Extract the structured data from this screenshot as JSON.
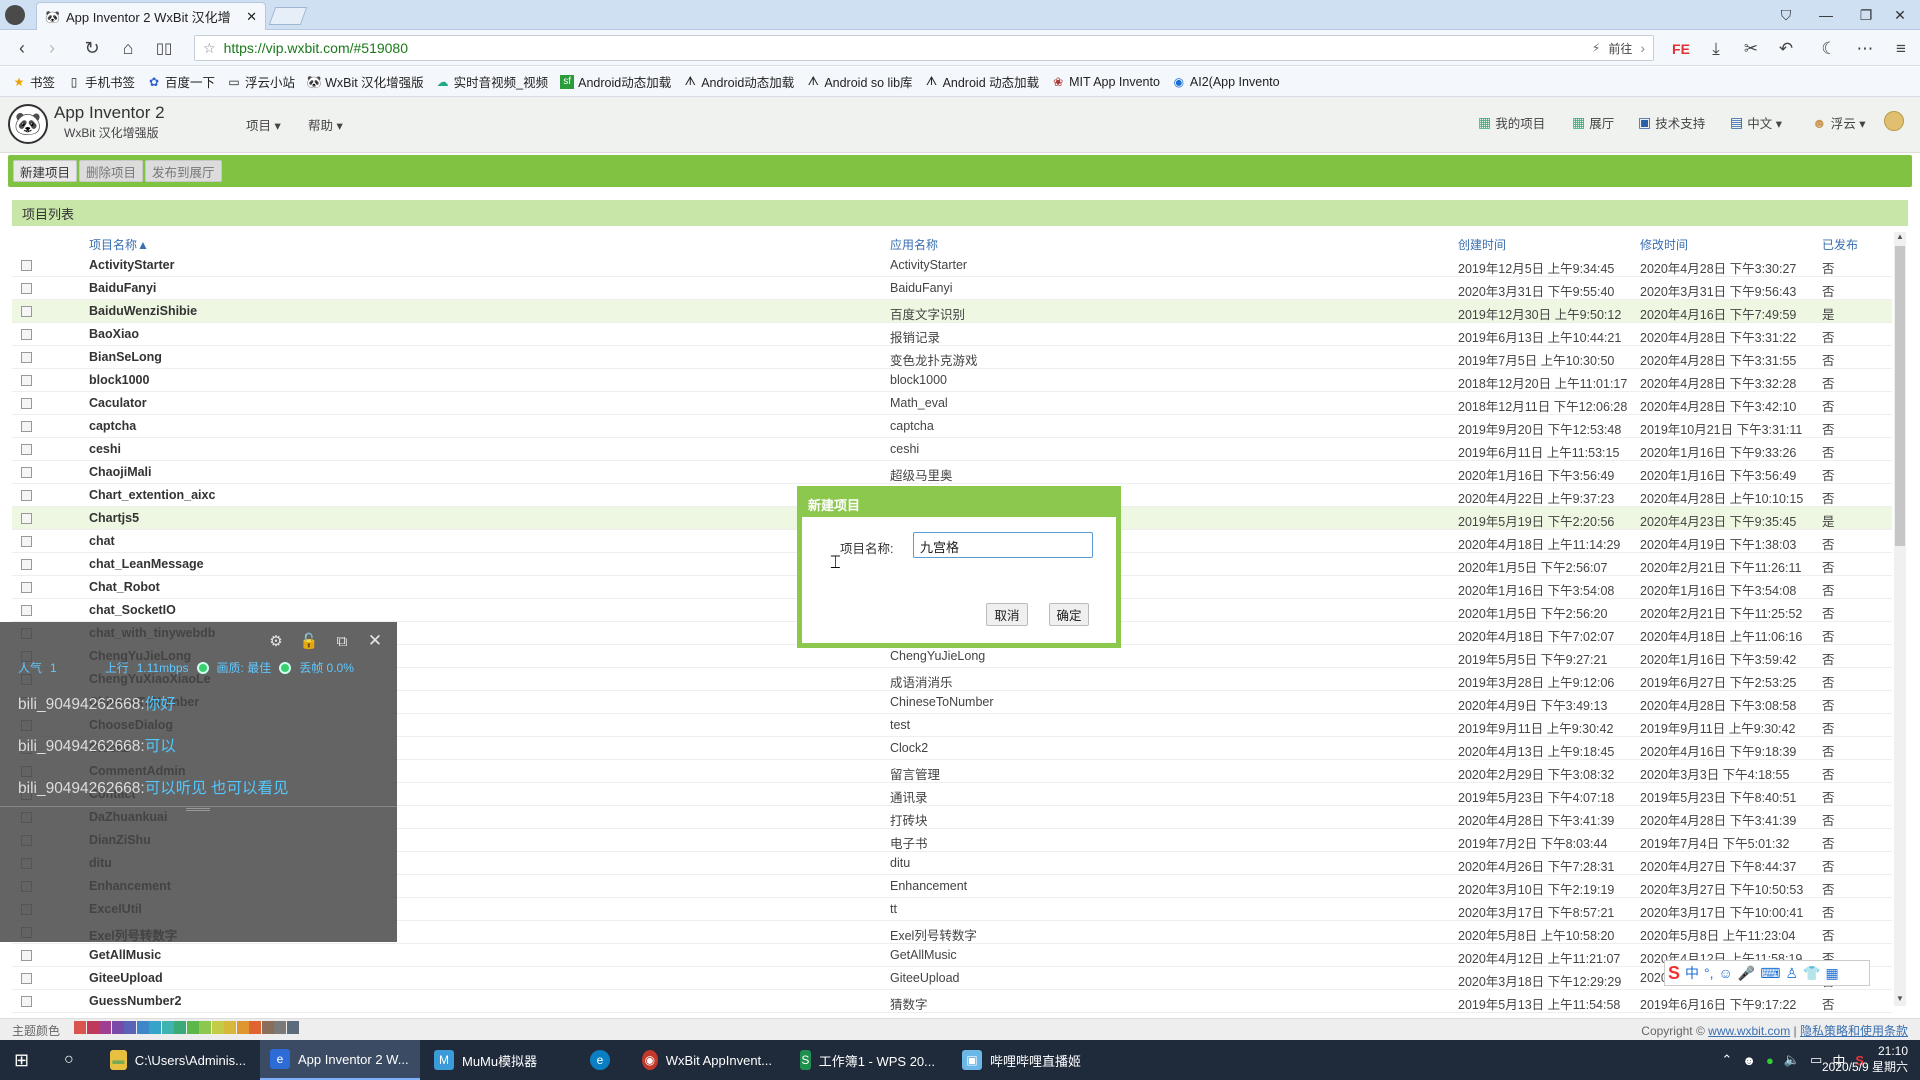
{
  "browser": {
    "tab_title": "App Inventor 2 WxBit 汉化增",
    "url": "https://vip.wxbit.com/#519080",
    "go_label": "前往",
    "bookmarks": [
      "书签",
      "手机书签",
      "百度一下",
      "浮云小站",
      "WxBit 汉化增强版",
      "实时音视频_视频",
      "Android动态加载",
      "Android动态加载",
      "Android so lib库",
      "Android 动态加载",
      "MIT App Invento",
      "AI2(App Invento"
    ]
  },
  "app": {
    "title": "App Inventor 2",
    "subtitle": "WxBit 汉化增强版",
    "menu": [
      "项目 ▾",
      "帮助 ▾"
    ],
    "right_menu": [
      "我的项目",
      "展厅",
      "技术支持",
      "中文 ▾",
      "浮云 ▾"
    ]
  },
  "toolbar": {
    "new": "新建项目",
    "delete": "删除项目",
    "publish": "发布到展厅"
  },
  "list": {
    "heading": "项目列表",
    "columns": [
      "项目名称▲",
      "应用名称",
      "创建时间",
      "修改时间",
      "已发布"
    ],
    "rows": [
      [
        "ActivityStarter",
        "ActivityStarter",
        "2019年12月5日 上午9:34:45",
        "2020年4月28日 下午3:30:27",
        "否"
      ],
      [
        "BaiduFanyi",
        "BaiduFanyi",
        "2020年3月31日 下午9:55:40",
        "2020年3月31日 下午9:56:43",
        "否"
      ],
      [
        "BaiduWenziShibie",
        "百度文字识别",
        "2019年12月30日 上午9:50:12",
        "2020年4月16日 下午7:49:59",
        "是"
      ],
      [
        "BaoXiao",
        "报销记录",
        "2019年6月13日 上午10:44:21",
        "2020年4月28日 下午3:31:22",
        "否"
      ],
      [
        "BianSeLong",
        "变色龙扑克游戏",
        "2019年7月5日 上午10:30:50",
        "2020年4月28日 下午3:31:55",
        "否"
      ],
      [
        "block1000",
        "block1000",
        "2018年12月20日 上午11:01:17",
        "2020年4月28日 下午3:32:28",
        "否"
      ],
      [
        "Caculator",
        "Math_eval",
        "2018年12月11日 下午12:06:28",
        "2020年4月28日 下午3:42:10",
        "否"
      ],
      [
        "captcha",
        "captcha",
        "2019年9月20日 下午12:53:48",
        "2019年10月21日 下午3:31:11",
        "否"
      ],
      [
        "ceshi",
        "ceshi",
        "2019年6月11日 上午11:53:15",
        "2020年1月16日 下午9:33:26",
        "否"
      ],
      [
        "ChaojiMali",
        "超级马里奥",
        "2020年1月16日 下午3:56:49",
        "2020年1月16日 下午3:56:49",
        "否"
      ],
      [
        "Chart_extention_aixc",
        "",
        "2020年4月22日 上午9:37:23",
        "2020年4月28日 上午10:10:15",
        "否"
      ],
      [
        "Chartjs5",
        "",
        "2019年5月19日 下午2:20:56",
        "2020年4月23日 下午9:35:45",
        "是"
      ],
      [
        "chat",
        "",
        "2020年4月18日 上午11:14:29",
        "2020年4月19日 下午1:38:03",
        "否"
      ],
      [
        "chat_LeanMessage",
        "",
        "2020年1月5日 下午2:56:07",
        "2020年2月21日 下午11:26:11",
        "否"
      ],
      [
        "Chat_Robot",
        "",
        "2020年1月16日 下午3:54:08",
        "2020年1月16日 下午3:54:08",
        "否"
      ],
      [
        "chat_SocketIO",
        "",
        "2020年1月5日 下午2:56:20",
        "2020年2月21日 下午11:25:52",
        "否"
      ],
      [
        "chat_with_tinywebdb",
        "",
        "2020年4月18日 下午7:02:07",
        "2020年4月18日 上午11:06:16",
        "否"
      ],
      [
        "ChengYuJieLong",
        "ChengYuJieLong",
        "2019年5月5日 下午9:27:21",
        "2020年1月16日 下午3:59:42",
        "否"
      ],
      [
        "ChengYuXiaoXiaoLe",
        "成语消消乐",
        "2019年3月28日 上午9:12:06",
        "2019年6月27日 下午2:53:25",
        "否"
      ],
      [
        "ChineseToNumber",
        "ChineseToNumber",
        "2020年4月9日 下午3:49:13",
        "2020年4月28日 下午3:08:58",
        "否"
      ],
      [
        "ChooseDialog",
        "test",
        "2019年9月11日 上午9:30:42",
        "2019年9月11日 上午9:30:42",
        "否"
      ],
      [
        "Clock2",
        "Clock2",
        "2020年4月13日 上午9:18:45",
        "2020年4月16日 下午9:18:39",
        "否"
      ],
      [
        "CommentAdmin",
        "留言管理",
        "2020年2月29日 下午3:08:32",
        "2020年3月3日 下午4:18:55",
        "否"
      ],
      [
        "Contact",
        "通讯录",
        "2019年5月23日 下午4:07:18",
        "2019年5月23日 下午8:40:51",
        "否"
      ],
      [
        "DaZhuankuai",
        "打砖块",
        "2020年4月28日 下午3:41:39",
        "2020年4月28日 下午3:41:39",
        "否"
      ],
      [
        "DianZiShu",
        "电子书",
        "2019年7月2日 下午8:03:44",
        "2019年7月4日 下午5:01:32",
        "否"
      ],
      [
        "ditu",
        "ditu",
        "2020年4月26日 下午7:28:31",
        "2020年4月27日 下午8:44:37",
        "否"
      ],
      [
        "Enhancement",
        "Enhancement",
        "2020年3月10日 下午2:19:19",
        "2020年3月27日 下午10:50:53",
        "否"
      ],
      [
        "ExcelUtil",
        "tt",
        "2020年3月17日 下午8:57:21",
        "2020年3月17日 下午10:00:41",
        "否"
      ],
      [
        "Exel列号转数字",
        "Exel列号转数字",
        "2020年5月8日 上午10:58:20",
        "2020年5月8日 上午11:23:04",
        "否"
      ],
      [
        "GetAllMusic",
        "GetAllMusic",
        "2020年4月12日 上午11:21:07",
        "2020年4月12日 上午11:58:19",
        "否"
      ],
      [
        "GiteeUpload",
        "GiteeUpload",
        "2020年3月18日 下午12:29:29",
        "2020",
        "否"
      ],
      [
        "GuessNumber2",
        "猜数字",
        "2019年5月13日 上午11:54:58",
        "2019年6月16日 下午9:17:22",
        "否"
      ]
    ]
  },
  "dialog": {
    "title": "新建项目",
    "label": "项目名称:",
    "value": "九宫格",
    "cancel": "取消",
    "ok": "确定"
  },
  "overlay": {
    "stats": [
      "人气",
      "1",
      "上行",
      "1.11mbps",
      "画质: 最佳",
      "丢帧 0.0%"
    ],
    "messages": [
      {
        "user": "bili_90494262668:",
        "text": "你好"
      },
      {
        "user": "bili_90494262668:",
        "text": "可以"
      },
      {
        "user": "bili_90494262668:",
        "text": "可以听见  也可以看见"
      }
    ]
  },
  "footer": {
    "theme_label": "主题颜色",
    "swatches": [
      "#d9534f",
      "#c0395a",
      "#a03f8f",
      "#7a4aa8",
      "#5a63b8",
      "#3f86c8",
      "#36a3c9",
      "#3fb3b0",
      "#3caa78",
      "#5bb848",
      "#8dc84e",
      "#c3cc46",
      "#d8b83a",
      "#e0962f",
      "#e0642f",
      "#8a6d5a",
      "#7a7a7a",
      "#5b6b7a"
    ],
    "copyright": "Copyright ©",
    "copyright_link": "www.wxbit.com",
    "privacy_link": "隐私策略和使用条款"
  },
  "taskbar": {
    "items": [
      "C:\\Users\\Adminis...",
      "App Inventor 2 W...",
      "MuMu模拟器",
      "WxBit AppInvent...",
      "工作簿1 - WPS 20...",
      "哔哩哔哩直播姬"
    ],
    "tray_lang": "中",
    "time": "21:10",
    "date": "2020/5/9 星期六"
  }
}
